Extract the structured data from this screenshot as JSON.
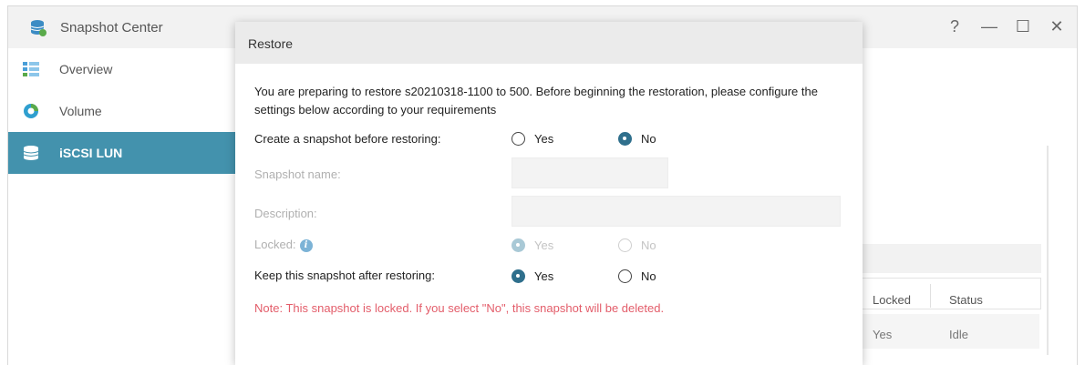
{
  "window": {
    "title": "Snapshot Center",
    "controls": {
      "help": "?",
      "minimize": "—",
      "maximize": "☐",
      "close": "✕"
    }
  },
  "sidebar": {
    "items": [
      {
        "label": "Overview",
        "icon": "overview-icon",
        "selected": false
      },
      {
        "label": "Volume",
        "icon": "volume-icon",
        "selected": false
      },
      {
        "label": "iSCSI LUN",
        "icon": "iscsi-lun-icon",
        "selected": true
      }
    ]
  },
  "background_table": {
    "columns": [
      "Locked",
      "Status"
    ],
    "rows": [
      {
        "locked": "Yes",
        "status": "Idle"
      }
    ]
  },
  "dialog": {
    "title": "Restore",
    "intro": "You are preparing to restore s20210318-1100 to 500. Before beginning the restoration, please configure the settings below according to your requirements",
    "create_snapshot": {
      "label": "Create a snapshot before restoring:",
      "options": [
        "Yes",
        "No"
      ],
      "selected": "No"
    },
    "snapshot_name": {
      "label": "Snapshot name:",
      "value": ""
    },
    "description": {
      "label": "Description:",
      "value": ""
    },
    "locked": {
      "label": "Locked:",
      "options": [
        "Yes",
        "No"
      ],
      "selected": "Yes",
      "disabled": true
    },
    "keep_snapshot": {
      "label": "Keep this snapshot after restoring:",
      "options": [
        "Yes",
        "No"
      ],
      "selected": "Yes"
    },
    "note": "Note: This snapshot is locked. If you select \"No\", this snapshot will be deleted."
  },
  "colors": {
    "accent": "#4392ad",
    "radio_on": "#2f6f8c",
    "note": "#e35d6a"
  }
}
